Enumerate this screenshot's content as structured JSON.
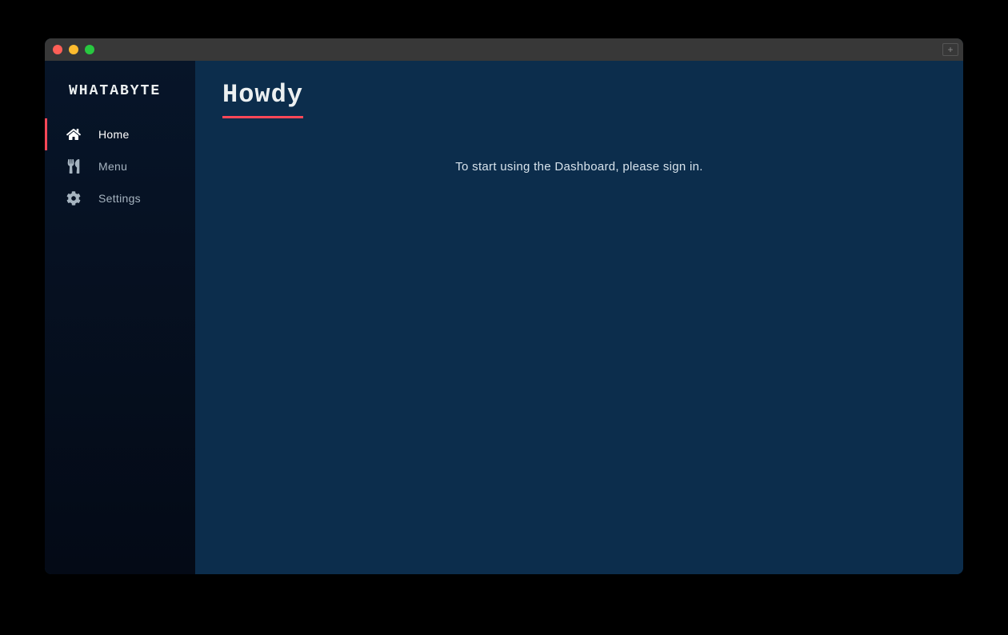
{
  "titlebar": {
    "plus_label": "+"
  },
  "sidebar": {
    "logo": "WHATABYTE",
    "items": [
      {
        "label": "Home",
        "icon": "home-icon",
        "active": true
      },
      {
        "label": "Menu",
        "icon": "utensils-icon",
        "active": false
      },
      {
        "label": "Settings",
        "icon": "gear-icon",
        "active": false
      }
    ]
  },
  "main": {
    "title": "Howdy",
    "message": "To start using the Dashboard, please sign in."
  },
  "colors": {
    "accent": "#ff4757",
    "bg_main": "#0c2d4c",
    "bg_sidebar": "#071529",
    "text_primary": "#ecf0f1",
    "text_muted": "#a6b4c0"
  }
}
